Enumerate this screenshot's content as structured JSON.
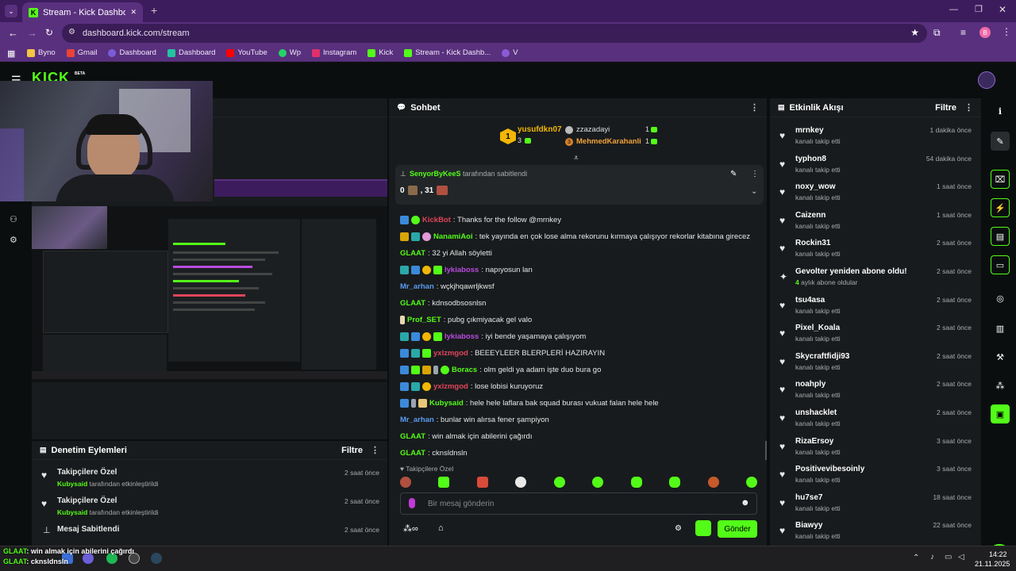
{
  "browser": {
    "tab_title": "Stream - Kick Dashboard",
    "tab_close": "✕",
    "new_tab": "+",
    "url": "dashboard.kick.com/stream",
    "profile_initial": "B",
    "bookmarks": [
      {
        "label": "Byno",
        "color": "#f4c542"
      },
      {
        "label": "Gmail",
        "color": "#ea4335"
      },
      {
        "label": "Dashboard",
        "color": "#7b5cd6"
      },
      {
        "label": "Dashboard",
        "color": "#25c2a0"
      },
      {
        "label": "YouTube",
        "color": "#ff0000"
      },
      {
        "label": "Wp",
        "color": "#25d366"
      },
      {
        "label": "Instagram",
        "color": "#e1306c"
      },
      {
        "label": "Kick",
        "color": "#53fc18"
      },
      {
        "label": "Stream - Kick Dashb...",
        "color": "#53fc18"
      },
      {
        "label": "V",
        "color": "#8a5bd6"
      }
    ]
  },
  "kick": {
    "logo": "KICK",
    "beta": "BETA"
  },
  "moderation": {
    "title": "Denetim Eylemleri",
    "filter": "Filtre",
    "items": [
      {
        "title": "Takipçilere Özel",
        "user": "Kubysaid",
        "rest": "tarafından etkinleştirildi",
        "time": "2 saat önce"
      },
      {
        "title": "Takipçilere Özel",
        "user": "Kubysaid",
        "rest": "tarafından etkinleştirildi",
        "time": "2 saat önce"
      },
      {
        "title": "Mesaj Sabitlendi",
        "user": "",
        "rest": "",
        "time": "2 saat önce"
      }
    ]
  },
  "chat": {
    "title": "Sohbet",
    "leaderboard": {
      "first_rank": "1",
      "first_name": "yusufdkn07",
      "first_count": "3",
      "second_name": "zzazadayi",
      "second_count": "1",
      "third_rank": "3",
      "third_name": "MehmedKarahanli",
      "third_count": "1"
    },
    "pinned": {
      "user": "SenyorByKeeS",
      "suffix": "tarafından sabitlendi",
      "text_a": "0",
      "text_b": ", 31"
    },
    "messages": [
      {
        "user": "KickBot",
        "color": "#e0455c",
        "text": ": Thanks for the follow @mrnkey"
      },
      {
        "user": "NanamiAoi",
        "color": "#53fc18",
        "text": ": tek yayında en çok lose alma rekorunu kırmaya çalışıyor rekorlar kitabına girecez"
      },
      {
        "user": "GLAAT",
        "color": "#53fc18",
        "text": ": 32 yi Allah söyletti"
      },
      {
        "user": "lykiaboss",
        "color": "#b94be0",
        "text": ": napıyosun lan"
      },
      {
        "user": "Mr_arhan",
        "color": "#5a9bf0",
        "text": ": wçkjhqawrljkwsf"
      },
      {
        "user": "GLAAT",
        "color": "#53fc18",
        "text": ": kdnsodbsosnlsn"
      },
      {
        "user": "Prof_SET",
        "color": "#53fc18",
        "text": ": pubg çıkmiyacak gel valo"
      },
      {
        "user": "lykiaboss",
        "color": "#b94be0",
        "text": ": iyi bende yaşamaya çalışıyom"
      },
      {
        "user": "yxlzmgod",
        "color": "#e0455c",
        "text": ": BEEEYLEER BLERPLERİ HAZIRAYIN"
      },
      {
        "user": "Boracs",
        "color": "#53fc18",
        "text": ": olm geldi ya adam işte duo bura go"
      },
      {
        "user": "yxlzmgod",
        "color": "#e0455c",
        "text": ": lose lobisi kuruyoruz"
      },
      {
        "user": "Kubysaid",
        "color": "#53fc18",
        "text": ": hele hele laflara bak squad burası vukuat falan hele hele"
      },
      {
        "user": "Mr_arhan",
        "color": "#5a9bf0",
        "text": ": bunlar win alırsa fener şampiyon"
      },
      {
        "user": "GLAAT",
        "color": "#53fc18",
        "text": ": win almak için abilerini çağırdı"
      },
      {
        "user": "GLAAT",
        "color": "#53fc18",
        "text": ": cknsldnsln"
      }
    ],
    "followers_only": "Takipçilere Özel",
    "input_placeholder": "Bir mesaj gönderin",
    "send": "Gönder"
  },
  "activity": {
    "title": "Etkinlik Akışı",
    "filter": "Filtre",
    "items": [
      {
        "name": "mrnkey",
        "sub": "kanalı takip etti",
        "time": "1 dakika önce",
        "icon": "heart"
      },
      {
        "name": "typhon8",
        "sub": "kanalı takip etti",
        "time": "54 dakika önce",
        "icon": "heart"
      },
      {
        "name": "noxy_wow",
        "sub": "kanalı takip etti",
        "time": "1 saat önce",
        "icon": "heart"
      },
      {
        "name": "Caizenn",
        "sub": "kanalı takip etti",
        "time": "1 saat önce",
        "icon": "heart"
      },
      {
        "name": "Rockin31",
        "sub": "kanalı takip etti",
        "time": "2 saat önce",
        "icon": "heart"
      },
      {
        "name": "Gevolter yeniden abone oldu!",
        "sub_num": "4",
        "sub": "aylık abone oldular",
        "time": "2 saat önce",
        "icon": "star"
      },
      {
        "name": "tsu4asa",
        "sub": "kanalı takip etti",
        "time": "2 saat önce",
        "icon": "heart"
      },
      {
        "name": "Pixel_Koala",
        "sub": "kanalı takip etti",
        "time": "2 saat önce",
        "icon": "heart"
      },
      {
        "name": "Skycraftfidji93",
        "sub": "kanalı takip etti",
        "time": "2 saat önce",
        "icon": "heart"
      },
      {
        "name": "noahply",
        "sub": "kanalı takip etti",
        "time": "2 saat önce",
        "icon": "heart"
      },
      {
        "name": "unshacklet",
        "sub": "kanalı takip etti",
        "time": "2 saat önce",
        "icon": "heart"
      },
      {
        "name": "RizaErsoy",
        "sub": "kanalı takip etti",
        "time": "3 saat önce",
        "icon": "heart"
      },
      {
        "name": "Positivevibesoinly",
        "sub": "kanalı takip etti",
        "time": "3 saat önce",
        "icon": "heart"
      },
      {
        "name": "hu7se7",
        "sub": "kanalı takip etti",
        "time": "18 saat önce",
        "icon": "heart"
      },
      {
        "name": "Biawyy",
        "sub": "kanalı takip etti",
        "time": "22 saat önce",
        "icon": "heart"
      }
    ]
  },
  "overlay_chat": [
    {
      "user": "GLAAT",
      "text": ": win almak için abilerini çağırdı"
    },
    {
      "user": "GLAAT",
      "text": ": cknsldnsln"
    }
  ],
  "taskbar": {
    "time": "14:22",
    "date": "21.11.2025"
  },
  "colors": {
    "kick_green": "#53fc18",
    "browser_purple": "#59307e",
    "panel": "#181b1d"
  }
}
